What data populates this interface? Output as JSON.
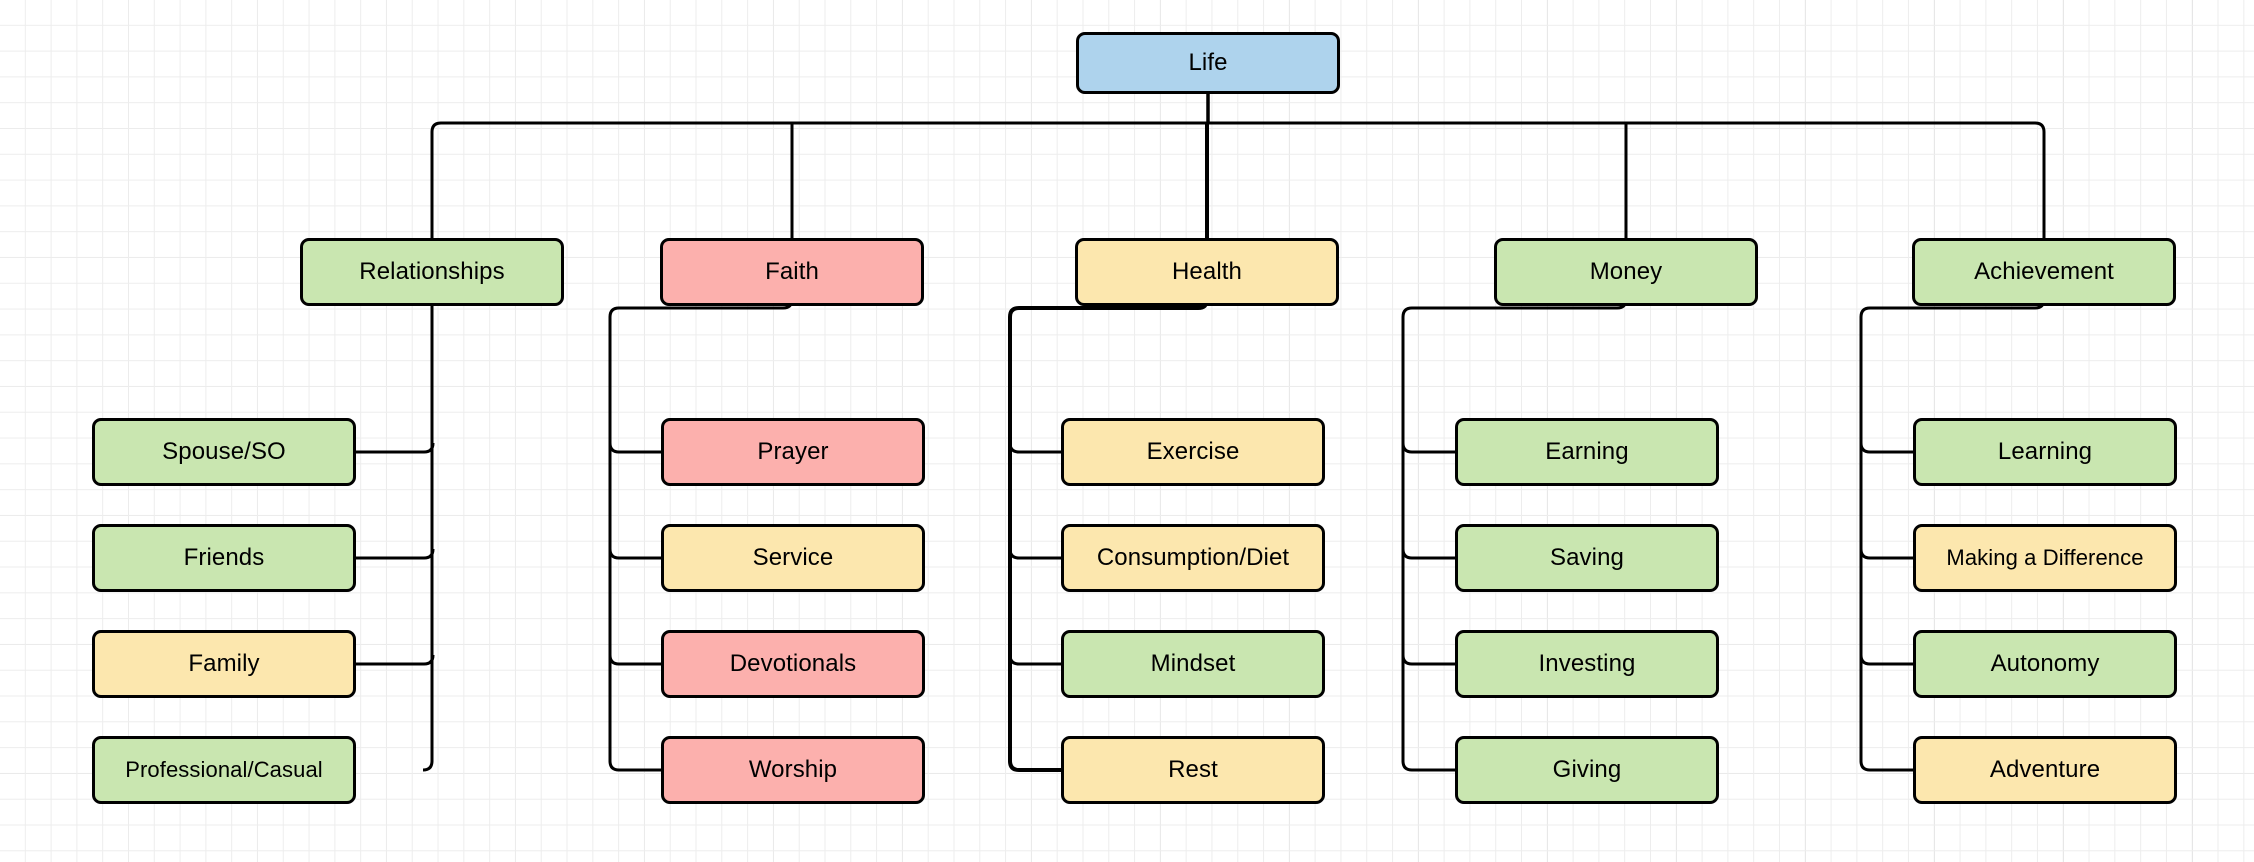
{
  "diagram": {
    "title": "Life",
    "palette": {
      "blue": "#aed3ed",
      "green": "#c9e6b0",
      "yellow": "#fce7ae",
      "pink": "#fcb0ad",
      "stroke": "#000000",
      "grid_minor": "#ededed",
      "grid_major": "#d5d5d5",
      "background": "#ffffff"
    },
    "root": {
      "label": "Life",
      "color": "blue"
    },
    "branches": [
      {
        "label": "Relationships",
        "color": "green",
        "children": [
          {
            "label": "Spouse/SO",
            "color": "green"
          },
          {
            "label": "Friends",
            "color": "green"
          },
          {
            "label": "Family",
            "color": "yellow"
          },
          {
            "label": "Professional/Casual",
            "color": "green"
          }
        ]
      },
      {
        "label": "Faith",
        "color": "pink",
        "children": [
          {
            "label": "Prayer",
            "color": "pink"
          },
          {
            "label": "Service",
            "color": "yellow"
          },
          {
            "label": "Devotionals",
            "color": "pink"
          },
          {
            "label": "Worship",
            "color": "pink"
          }
        ]
      },
      {
        "label": "Health",
        "color": "yellow",
        "children": [
          {
            "label": "Exercise",
            "color": "yellow"
          },
          {
            "label": "Consumption/Diet",
            "color": "yellow"
          },
          {
            "label": "Mindset",
            "color": "green"
          },
          {
            "label": "Rest",
            "color": "yellow"
          }
        ]
      },
      {
        "label": "Money",
        "color": "green",
        "children": [
          {
            "label": "Earning",
            "color": "green"
          },
          {
            "label": "Saving",
            "color": "green"
          },
          {
            "label": "Investing",
            "color": "green"
          },
          {
            "label": "Giving",
            "color": "green"
          }
        ]
      },
      {
        "label": "Achievement",
        "color": "green",
        "children": [
          {
            "label": "Learning",
            "color": "green"
          },
          {
            "label": "Making a Difference",
            "color": "yellow"
          },
          {
            "label": "Autonomy",
            "color": "green"
          },
          {
            "label": "Adventure",
            "color": "yellow"
          }
        ]
      }
    ]
  }
}
